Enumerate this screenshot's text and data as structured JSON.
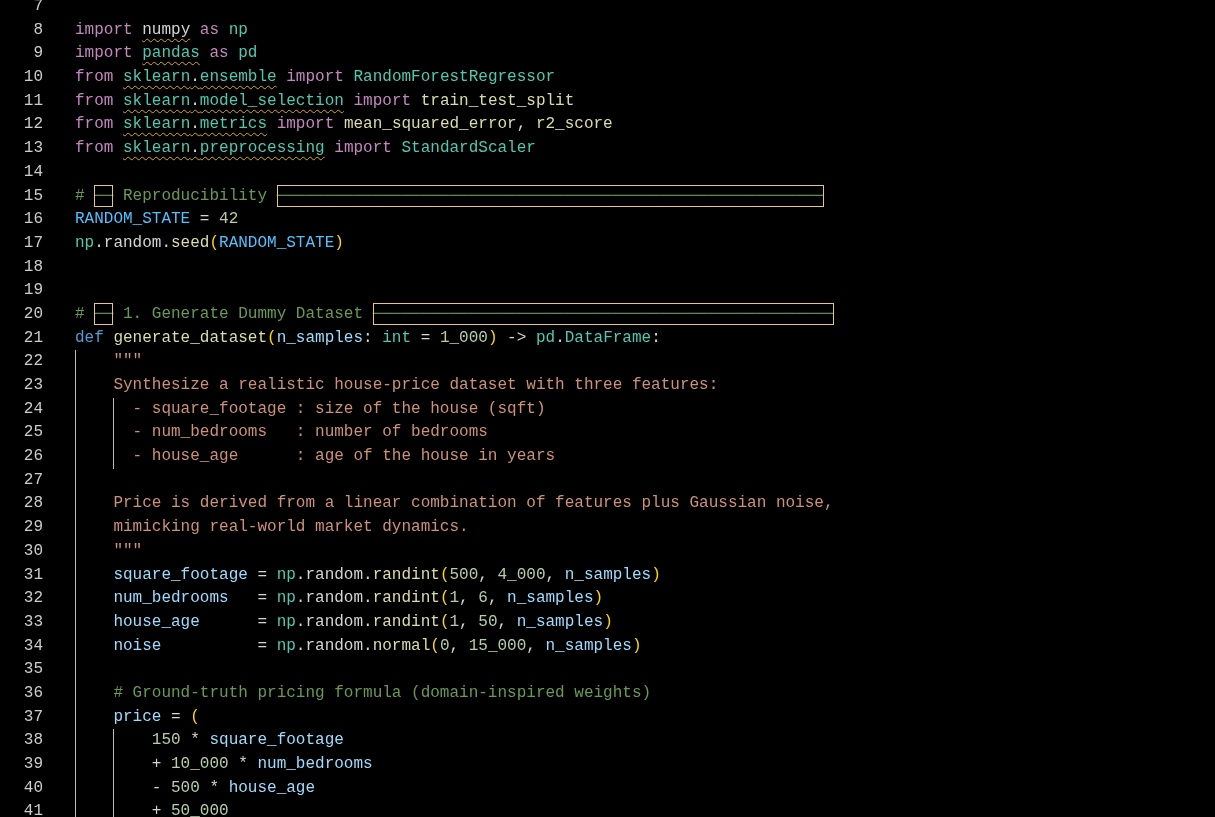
{
  "editor": {
    "lines": [
      {
        "number": "7"
      },
      {
        "number": "8",
        "tokens": [
          {
            "text": "import ",
            "kind": "keyword"
          },
          {
            "text": "numpy",
            "kind": "plain",
            "warning": true
          },
          {
            "text": " as ",
            "kind": "keyword"
          },
          {
            "text": "np",
            "kind": "module"
          }
        ]
      },
      {
        "number": "9",
        "tokens": [
          {
            "text": "import ",
            "kind": "keyword"
          },
          {
            "text": "pandas",
            "kind": "module",
            "warning": true
          },
          {
            "text": " as ",
            "kind": "keyword"
          },
          {
            "text": "pd",
            "kind": "module"
          }
        ]
      },
      {
        "number": "10",
        "tokens": [
          {
            "text": "from ",
            "kind": "keyword"
          },
          {
            "text": "sklearn",
            "kind": "module",
            "warning": true
          },
          {
            "text": ".",
            "kind": "plain",
            "warning": true
          },
          {
            "text": "ensemble",
            "kind": "module",
            "warning": true
          },
          {
            "text": " import ",
            "kind": "keyword"
          },
          {
            "text": "RandomForestRegressor",
            "kind": "type"
          }
        ]
      },
      {
        "number": "11",
        "tokens": [
          {
            "text": "from ",
            "kind": "keyword"
          },
          {
            "text": "sklearn",
            "kind": "module",
            "warning": true
          },
          {
            "text": ".",
            "kind": "plain",
            "warning": true
          },
          {
            "text": "model_selection",
            "kind": "module",
            "warning": true
          },
          {
            "text": " import ",
            "kind": "keyword"
          },
          {
            "text": "train_test_split",
            "kind": "function"
          }
        ]
      },
      {
        "number": "12",
        "tokens": [
          {
            "text": "from ",
            "kind": "keyword"
          },
          {
            "text": "sklearn",
            "kind": "module",
            "warning": true
          },
          {
            "text": ".",
            "kind": "plain",
            "warning": true
          },
          {
            "text": "metrics",
            "kind": "module",
            "warning": true
          },
          {
            "text": " import ",
            "kind": "keyword"
          },
          {
            "text": "mean_squared_error",
            "kind": "function"
          },
          {
            "text": ", ",
            "kind": "plain"
          },
          {
            "text": "r2_score",
            "kind": "function"
          }
        ]
      },
      {
        "number": "13",
        "tokens": [
          {
            "text": "from ",
            "kind": "keyword"
          },
          {
            "text": "sklearn",
            "kind": "module",
            "warning": true
          },
          {
            "text": ".",
            "kind": "plain",
            "warning": true
          },
          {
            "text": "preprocessing",
            "kind": "module",
            "warning": true
          },
          {
            "text": " import ",
            "kind": "keyword"
          },
          {
            "text": "StandardScaler",
            "kind": "type"
          }
        ]
      },
      {
        "number": "14"
      },
      {
        "number": "15",
        "tokens": [
          {
            "text": "# ",
            "kind": "comment"
          },
          {
            "text": "──",
            "kind": "comment",
            "highlight": true
          },
          {
            "text": " Reproducibility ",
            "kind": "comment"
          },
          {
            "text": "─────────────────────────────────────────────────────────",
            "kind": "comment",
            "highlight": true
          }
        ]
      },
      {
        "number": "16",
        "tokens": [
          {
            "text": "RANDOM_STATE",
            "kind": "constant"
          },
          {
            "text": " = ",
            "kind": "plain"
          },
          {
            "text": "42",
            "kind": "number"
          }
        ]
      },
      {
        "number": "17",
        "tokens": [
          {
            "text": "np",
            "kind": "module"
          },
          {
            "text": ".random.",
            "kind": "plain"
          },
          {
            "text": "seed",
            "kind": "function"
          },
          {
            "text": "(",
            "kind": "bracket"
          },
          {
            "text": "RANDOM_STATE",
            "kind": "constant"
          },
          {
            "text": ")",
            "kind": "bracket"
          }
        ]
      },
      {
        "number": "18"
      },
      {
        "number": "19"
      },
      {
        "number": "20",
        "tokens": [
          {
            "text": "# ",
            "kind": "comment"
          },
          {
            "text": "──",
            "kind": "comment",
            "highlight": true
          },
          {
            "text": " 1. Generate Dummy Dataset ",
            "kind": "comment"
          },
          {
            "text": "────────────────────────────────────────────────",
            "kind": "comment",
            "highlight": true
          }
        ]
      },
      {
        "number": "21",
        "tokens": [
          {
            "text": "def ",
            "kind": "storage"
          },
          {
            "text": "generate_dataset",
            "kind": "function"
          },
          {
            "text": "(",
            "kind": "bracket"
          },
          {
            "text": "n_samples",
            "kind": "variable"
          },
          {
            "text": ": ",
            "kind": "plain"
          },
          {
            "text": "int",
            "kind": "type"
          },
          {
            "text": " = ",
            "kind": "plain"
          },
          {
            "text": "1_000",
            "kind": "number"
          },
          {
            "text": ")",
            "kind": "bracket"
          },
          {
            "text": " -> ",
            "kind": "plain"
          },
          {
            "text": "pd",
            "kind": "module"
          },
          {
            "text": ".",
            "kind": "plain"
          },
          {
            "text": "DataFrame",
            "kind": "type"
          },
          {
            "text": ":",
            "kind": "plain"
          }
        ]
      },
      {
        "number": "22",
        "tokens": [
          {
            "text": "    \"\"\"",
            "kind": "string"
          }
        ]
      },
      {
        "number": "23",
        "tokens": [
          {
            "text": "    Synthesize a realistic house-price dataset with three features:",
            "kind": "string"
          }
        ]
      },
      {
        "number": "24",
        "tokens": [
          {
            "text": "      - square_footage : size of the house (sqft)",
            "kind": "string"
          }
        ]
      },
      {
        "number": "25",
        "tokens": [
          {
            "text": "      - num_bedrooms   : number of bedrooms",
            "kind": "string"
          }
        ]
      },
      {
        "number": "26",
        "tokens": [
          {
            "text": "      - house_age      : age of the house in years",
            "kind": "string"
          }
        ]
      },
      {
        "number": "27"
      },
      {
        "number": "28",
        "tokens": [
          {
            "text": "    Price is derived from a linear combination of features plus Gaussian noise,",
            "kind": "string"
          }
        ]
      },
      {
        "number": "29",
        "tokens": [
          {
            "text": "    mimicking real-world market dynamics.",
            "kind": "string"
          }
        ]
      },
      {
        "number": "30",
        "tokens": [
          {
            "text": "    \"\"\"",
            "kind": "string"
          }
        ]
      },
      {
        "number": "31",
        "tokens": [
          {
            "text": "    square_footage",
            "kind": "variable"
          },
          {
            "text": " = ",
            "kind": "plain"
          },
          {
            "text": "np",
            "kind": "module"
          },
          {
            "text": ".random.",
            "kind": "plain"
          },
          {
            "text": "randint",
            "kind": "function"
          },
          {
            "text": "(",
            "kind": "bracket"
          },
          {
            "text": "500",
            "kind": "number"
          },
          {
            "text": ", ",
            "kind": "plain"
          },
          {
            "text": "4_000",
            "kind": "number"
          },
          {
            "text": ", ",
            "kind": "plain"
          },
          {
            "text": "n_samples",
            "kind": "variable"
          },
          {
            "text": ")",
            "kind": "bracket"
          }
        ]
      },
      {
        "number": "32",
        "tokens": [
          {
            "text": "    num_bedrooms",
            "kind": "variable"
          },
          {
            "text": "   = ",
            "kind": "plain"
          },
          {
            "text": "np",
            "kind": "module"
          },
          {
            "text": ".random.",
            "kind": "plain"
          },
          {
            "text": "randint",
            "kind": "function"
          },
          {
            "text": "(",
            "kind": "bracket"
          },
          {
            "text": "1",
            "kind": "number"
          },
          {
            "text": ", ",
            "kind": "plain"
          },
          {
            "text": "6",
            "kind": "number"
          },
          {
            "text": ", ",
            "kind": "plain"
          },
          {
            "text": "n_samples",
            "kind": "variable"
          },
          {
            "text": ")",
            "kind": "bracket"
          }
        ]
      },
      {
        "number": "33",
        "tokens": [
          {
            "text": "    house_age",
            "kind": "variable"
          },
          {
            "text": "      = ",
            "kind": "plain"
          },
          {
            "text": "np",
            "kind": "module"
          },
          {
            "text": ".random.",
            "kind": "plain"
          },
          {
            "text": "randint",
            "kind": "function"
          },
          {
            "text": "(",
            "kind": "bracket"
          },
          {
            "text": "1",
            "kind": "number"
          },
          {
            "text": ", ",
            "kind": "plain"
          },
          {
            "text": "50",
            "kind": "number"
          },
          {
            "text": ", ",
            "kind": "plain"
          },
          {
            "text": "n_samples",
            "kind": "variable"
          },
          {
            "text": ")",
            "kind": "bracket"
          }
        ]
      },
      {
        "number": "34",
        "tokens": [
          {
            "text": "    noise",
            "kind": "variable"
          },
          {
            "text": "          = ",
            "kind": "plain"
          },
          {
            "text": "np",
            "kind": "module"
          },
          {
            "text": ".random.",
            "kind": "plain"
          },
          {
            "text": "normal",
            "kind": "function"
          },
          {
            "text": "(",
            "kind": "bracket"
          },
          {
            "text": "0",
            "kind": "number"
          },
          {
            "text": ", ",
            "kind": "plain"
          },
          {
            "text": "15_000",
            "kind": "number"
          },
          {
            "text": ", ",
            "kind": "plain"
          },
          {
            "text": "n_samples",
            "kind": "variable"
          },
          {
            "text": ")",
            "kind": "bracket"
          }
        ]
      },
      {
        "number": "35"
      },
      {
        "number": "36",
        "tokens": [
          {
            "text": "    # Ground-truth pricing formula (domain-inspired weights)",
            "kind": "comment"
          }
        ]
      },
      {
        "number": "37",
        "tokens": [
          {
            "text": "    price",
            "kind": "variable"
          },
          {
            "text": " = ",
            "kind": "plain"
          },
          {
            "text": "(",
            "kind": "bracket"
          }
        ]
      },
      {
        "number": "38",
        "tokens": [
          {
            "text": "        150",
            "kind": "number"
          },
          {
            "text": " * ",
            "kind": "plain"
          },
          {
            "text": "square_footage",
            "kind": "variable"
          }
        ]
      },
      {
        "number": "39",
        "tokens": [
          {
            "text": "        + ",
            "kind": "plain"
          },
          {
            "text": "10_000",
            "kind": "number"
          },
          {
            "text": " * ",
            "kind": "plain"
          },
          {
            "text": "num_bedrooms",
            "kind": "variable"
          }
        ]
      },
      {
        "number": "40",
        "tokens": [
          {
            "text": "        - ",
            "kind": "plain"
          },
          {
            "text": "500",
            "kind": "number"
          },
          {
            "text": " * ",
            "kind": "plain"
          },
          {
            "text": "house_age",
            "kind": "variable"
          }
        ]
      },
      {
        "number": "41",
        "tokens": [
          {
            "text": "        + ",
            "kind": "plain"
          },
          {
            "text": "50_000",
            "kind": "number"
          }
        ]
      }
    ]
  }
}
